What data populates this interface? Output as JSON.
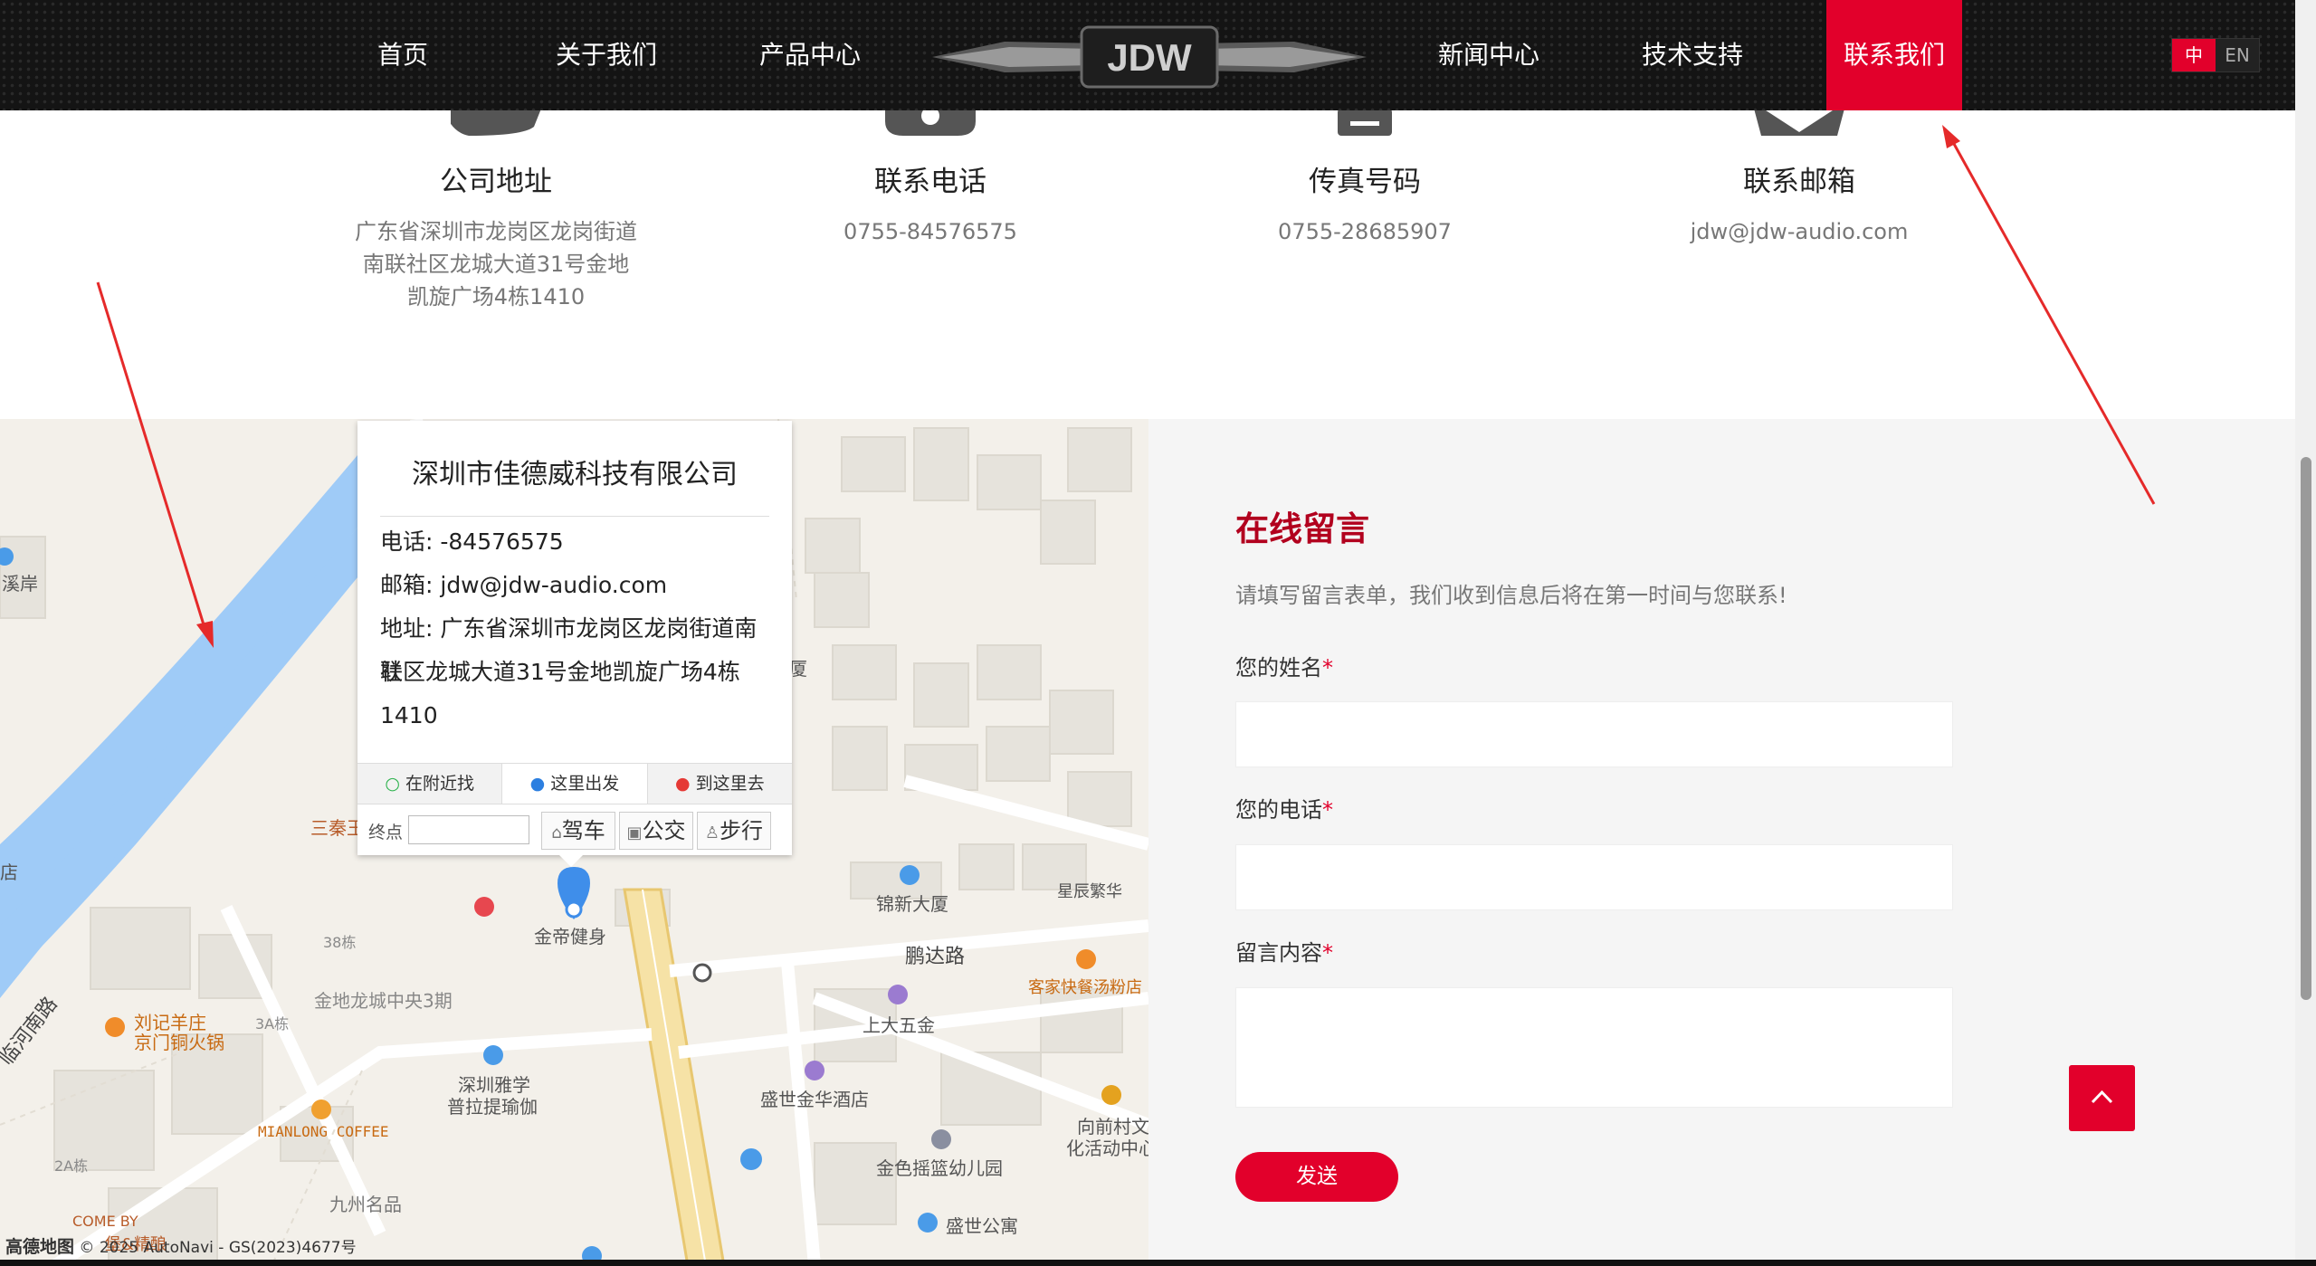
{
  "nav": {
    "items": [
      "首页",
      "关于我们",
      "产品中心",
      "新闻中心",
      "技术支持",
      "联系我们"
    ],
    "active": "联系我们",
    "logo_text": "JDW",
    "lang": {
      "zh": "中",
      "en": "EN"
    }
  },
  "contacts": [
    {
      "title": "公司地址",
      "lines": [
        "广东省深圳市龙岗区龙岗街道",
        "南联社区龙城大道31号金地",
        "凯旋广场4栋1410"
      ]
    },
    {
      "title": "联系电话",
      "lines": [
        "0755-84576575"
      ]
    },
    {
      "title": "传真号码",
      "lines": [
        "0755-28685907"
      ]
    },
    {
      "title": "联系邮箱",
      "lines": [
        "jdw@jdw-audio.com"
      ]
    }
  ],
  "map": {
    "info": {
      "title": "深圳市佳德威科技有限公司",
      "phone": "电话: -84576575",
      "email": "邮箱: jdw@jdw-audio.com",
      "address_1": "地址: 广东省深圳市龙岗区龙岗街道南联",
      "address_2": "社区龙城大道31号金地凯旋广场4栋",
      "address_3": "1410",
      "tabs": [
        "在附近找",
        "这里出发",
        "到这里去"
      ],
      "endpoint_label": "终点",
      "modes": [
        "驾车",
        "公交",
        "步行"
      ]
    },
    "pois": {
      "xian": "溪岸",
      "dian": "店",
      "sanqin": "三秦王",
      "jindi": "金帝健身",
      "jinxin": "锦新大厦",
      "xingchen": "星辰繁华",
      "pengda": "鹏达路",
      "kejia": "客家快餐汤粉店",
      "shangda": "上大五金",
      "jindilc": "金地龙城中央3期",
      "liuji1": "刘记羊庄",
      "liuji2": "京门铜火锅",
      "yaxue1": "深圳雅学",
      "yaxue2": "普拉提瑜伽",
      "miantong": "MIANLONG COFFEE",
      "shengshi": "盛世金华酒店",
      "xiangqian1": "向前村文",
      "xiangqian2": "化活动中心",
      "jiuzhou": "九州名品",
      "jinse": "金色摇篮幼儿园",
      "shengshigy": "盛世公寓",
      "linhe": "临河南路",
      "b38": "38栋",
      "b3a": "3A栋",
      "b2a": "2A栋",
      "comeby": "COME BY",
      "bao": "堡&精酿",
      "xia": "厦"
    },
    "copyright_logo": "高德地图",
    "copyright": "© 2025 AutoNavi - GS(2023)4677号"
  },
  "form": {
    "title": "在线留言",
    "desc": "请填写留言表单，我们收到信息后将在第一时间与您联系!",
    "name_label": "您的姓名",
    "phone_label": "您的电话",
    "message_label": "留言内容",
    "required_mark": "*",
    "send": "发送"
  },
  "colors": {
    "brand": "#e2002b",
    "title": "#b2001e",
    "river": "#9fcbf7"
  }
}
